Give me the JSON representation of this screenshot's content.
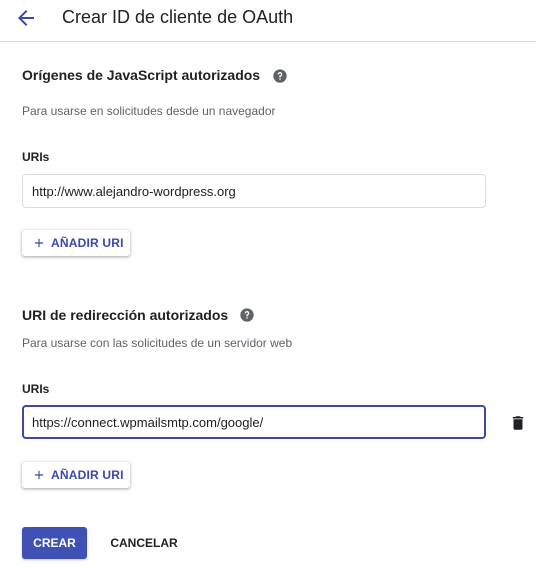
{
  "header": {
    "title": "Crear ID de cliente de OAuth",
    "back_icon": "arrow-back-icon"
  },
  "colors": {
    "accent": "#3949ab",
    "primary_button": "#3f51b5"
  },
  "js_origins": {
    "title": "Orígenes de JavaScript autorizados",
    "description": "Para usarse en solicitudes desde un navegador",
    "uris_label": "URIs",
    "uri_value": "http://www.alejandro-wordpress.org",
    "add_label": "AÑADIR URI"
  },
  "redirect_uris": {
    "title": "URI de redirección autorizados",
    "description": "Para usarse con las solicitudes de un servidor web",
    "uris_label": "URIs",
    "uri_value": "https://connect.wpmailsmtp.com/google/",
    "add_label": "AÑADIR URI"
  },
  "actions": {
    "create_label": "CREAR",
    "cancel_label": "CANCELAR"
  }
}
